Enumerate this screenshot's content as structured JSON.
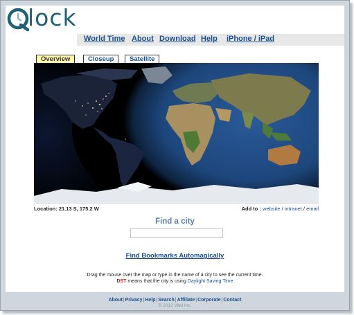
{
  "brand": {
    "logo_text": "lock"
  },
  "nav": {
    "items": [
      {
        "label": "World Time"
      },
      {
        "label": "About"
      },
      {
        "label": "Download"
      },
      {
        "label": "Help"
      },
      {
        "label": "iPhone / iPad"
      }
    ]
  },
  "tabs": [
    {
      "label": "Overview",
      "selected": true
    },
    {
      "label": "Closeup",
      "selected": false
    },
    {
      "label": "Satellite",
      "selected": false
    }
  ],
  "map": {
    "location_text": "Location: 21.13 S, 175.2 W"
  },
  "add_to": {
    "label": "Add to :",
    "website": "website",
    "sep1": " / ",
    "intranet": "intranet",
    "sep2": " / ",
    "email": "email"
  },
  "search": {
    "title": "Find a city",
    "value": "",
    "placeholder": ""
  },
  "bookmarks_link": "Find Bookmarks Automagically",
  "help": {
    "line1": "Drag the mouse over the map or type in the name of a city to see the current time.",
    "dst_label": "DST",
    "line2_mid": " means that the city is using ",
    "dst_link": "Daylight Saving Time"
  },
  "footer": {
    "links": [
      "About",
      "Privacy",
      "Help",
      "Search",
      "Affiliate",
      "Corporate",
      "Contact"
    ],
    "copyright": "© 2012 Vitei Inc."
  },
  "colors": {
    "link": "#1a4f8c",
    "logo": "#1f5f78",
    "selected_tab": "#fff8b0",
    "dst": "#cc1a1a"
  }
}
